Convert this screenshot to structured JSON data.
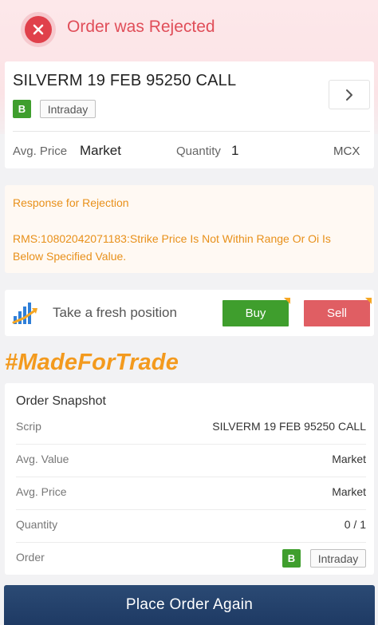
{
  "header": {
    "title": "Order was Rejected",
    "icon": "close-icon",
    "color": "#e04e59"
  },
  "order": {
    "name": "SILVERM 19 FEB 95250 CALL",
    "side_badge": "B",
    "product": "Intraday",
    "avg_price_label": "Avg. Price",
    "avg_price_value": "Market",
    "quantity_label": "Quantity",
    "quantity_value": "1",
    "exchange": "MCX"
  },
  "rejection": {
    "heading": "Response for Rejection",
    "message": "RMS:10802042071183:Strike Price Is Not Within Range Or Oi Is Below Specified Value.",
    "color": "#e8901a"
  },
  "fresh_position": {
    "label": "Take a fresh position",
    "buy_label": "Buy",
    "sell_label": "Sell",
    "icon": "bar-chart-icon"
  },
  "hashtag": "#MadeForTrade",
  "snapshot": {
    "title": "Order Snapshot",
    "rows": [
      {
        "label": "Scrip",
        "value": "SILVERM 19 FEB 95250 CALL"
      },
      {
        "label": "Avg. Value",
        "value": "Market"
      },
      {
        "label": "Avg. Price",
        "value": "Market"
      },
      {
        "label": "Quantity",
        "value": "0 / 1"
      },
      {
        "label": "Order",
        "value": ""
      }
    ],
    "order_badge": "B",
    "order_product": "Intraday"
  },
  "footer": {
    "place_again_label": "Place Order Again"
  },
  "colors": {
    "buy": "#3f9e2d",
    "sell": "#e05e63",
    "accent": "#f39a1e",
    "primary": "#1e3a64"
  }
}
